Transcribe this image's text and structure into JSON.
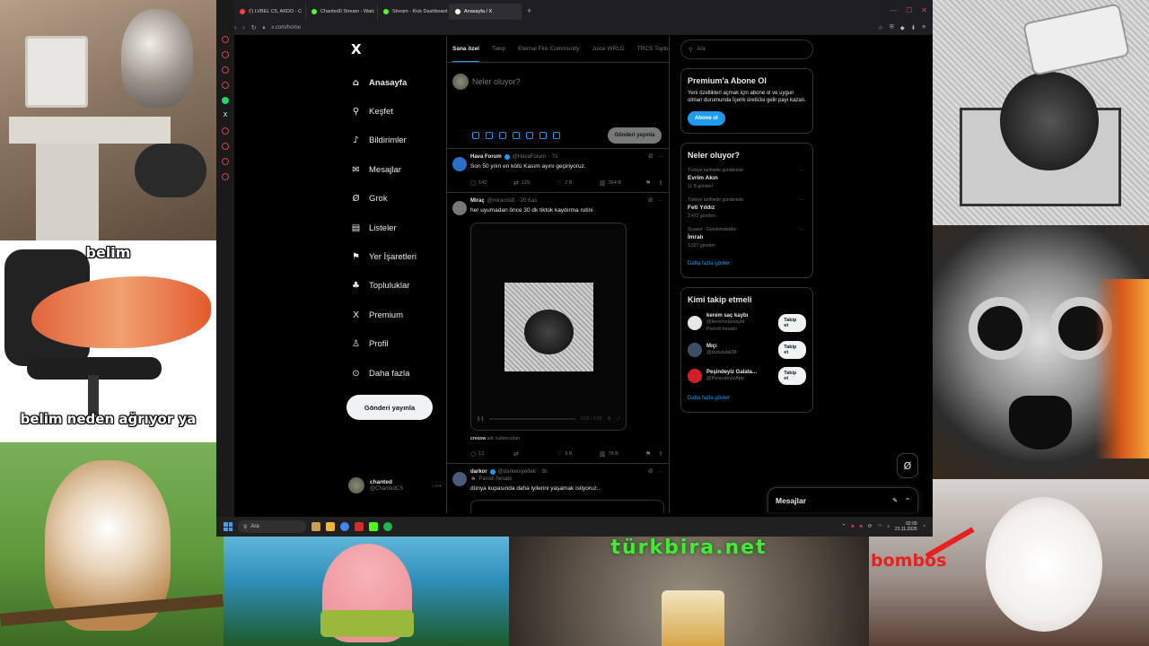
{
  "overlays": {
    "shrimp_top": "belim",
    "shrimp_bottom": "belim neden ağrıyor ya",
    "beer_title": "türkbira.net",
    "whitecat_caption": "bombos"
  },
  "browser": {
    "tabs": [
      {
        "label": "(!) LVBEL C5, AKDO - C",
        "color": "#ff3d3d",
        "active": false
      },
      {
        "label": "Chanted0 Stream - Watc",
        "color": "#53fc18",
        "active": false
      },
      {
        "label": "Stream - Kick Dashboard",
        "color": "#53fc18",
        "active": false
      },
      {
        "label": "Anasayfa / X",
        "color": "#ffffff",
        "active": true
      }
    ],
    "new_tab": "+",
    "url": "x.com/home"
  },
  "xnav": {
    "logo": "X",
    "items": [
      {
        "label": "Anasayfa",
        "icon": "⌂",
        "name": "home"
      },
      {
        "label": "Keşfet",
        "icon": "⚲",
        "name": "explore"
      },
      {
        "label": "Bildirimler",
        "icon": "♪",
        "name": "notifications"
      },
      {
        "label": "Mesajlar",
        "icon": "✉",
        "name": "messages"
      },
      {
        "label": "Grok",
        "icon": "Ø",
        "name": "grok"
      },
      {
        "label": "Listeler",
        "icon": "▤",
        "name": "lists"
      },
      {
        "label": "Yer İşaretleri",
        "icon": "⚑",
        "name": "bookmarks"
      },
      {
        "label": "Topluluklar",
        "icon": "♣",
        "name": "communities"
      },
      {
        "label": "Premium",
        "icon": "X",
        "name": "premium"
      },
      {
        "label": "Profil",
        "icon": "♙",
        "name": "profile"
      },
      {
        "label": "Daha fazla",
        "icon": "⊙",
        "name": "more"
      }
    ],
    "post_button": "Gönderi yayınla",
    "account_name": "chanted",
    "account_handle": "@ChantedCS",
    "account_more": "···"
  },
  "timeline": {
    "tabs": [
      "Sana özel",
      "Takip",
      "Eternal Fire Community",
      "Juice WRLD",
      "TRCS Toplulu"
    ],
    "composer_placeholder": "Neler oluyor?",
    "composer_button": "Gönderi yayınla",
    "tweets": [
      {
        "name": "Hava Forum",
        "handle": "@HavaForum",
        "time": "· 7s",
        "text": "Son 50 yılın en kötü Kasım ayını geçiriyoruz.",
        "replies": "142",
        "reposts": "129",
        "likes": "2 B",
        "views": "364 B",
        "avatar": "#2a70c8"
      },
      {
        "name": "Miraç",
        "handle": "@miracristt",
        "time": "· 20 Kas",
        "text": "her uyumadan önce 30 dk tiktok kaydırma rutini",
        "replies": "13",
        "reposts": "",
        "likes": "9 B",
        "views": "78 B",
        "media_time": "0:02 / 0:02",
        "source_name": "crexow",
        "source_text": "adlı kullanıcıdan",
        "avatar": "#777777"
      },
      {
        "name": "darkor",
        "handle": "@darkersyedek",
        "time": "· 9s",
        "parody": "Parodi hesabı",
        "text": "dünya kupasında daha iyilerini yaşamak istiyoruz..",
        "avatar": "#4a5a7a"
      }
    ]
  },
  "rightcol": {
    "search_placeholder": "Ara",
    "premium_title": "Premium'a Abone Ol",
    "premium_desc": "Yeni özellikleri açmak için abone ol ve uygun olman durumunda İçerik üreticisi gelir payı kazan.",
    "premium_button": "Abone ol",
    "trends_title": "Neler oluyor?",
    "trends": [
      {
        "context": "Türkiye tarihinde gündemde",
        "title": "Evrim Akın",
        "count": "11 B gönderi"
      },
      {
        "context": "Türkiye tarihinde gündemde",
        "title": "Feti Yıldız",
        "count": "3.472 gönderi"
      },
      {
        "context": "Siyaset · Gündemdekiler",
        "title": "İmralı",
        "count": "3.527 gönderi"
      }
    ],
    "show_more": "Daha fazla göster",
    "who_title": "Kimi takip etmeli",
    "who": [
      {
        "name": "kerem saç kaybı",
        "handle": "@keremsackaybi",
        "note": "Parodi hesabı",
        "button": "Takip et",
        "avatar": "#e6e6e6"
      },
      {
        "name": "Mıçı",
        "handle": "@tozlututal38",
        "note": "",
        "button": "Takip et",
        "avatar": "#3d4f66"
      },
      {
        "name": "Peşindeyiz Galata...",
        "handle": "@PesindeyizApp",
        "note": "",
        "button": "Takip et",
        "avatar": "#d01f2a"
      }
    ],
    "who_show_more": "Daha fazla göster"
  },
  "dock": {
    "messages": "Mesajlar"
  },
  "taskbar": {
    "search": "Ara",
    "time": "02:09",
    "date": "21.11.2025"
  },
  "colors": {
    "accent": "#1d9bf0",
    "bg": "#000000"
  }
}
